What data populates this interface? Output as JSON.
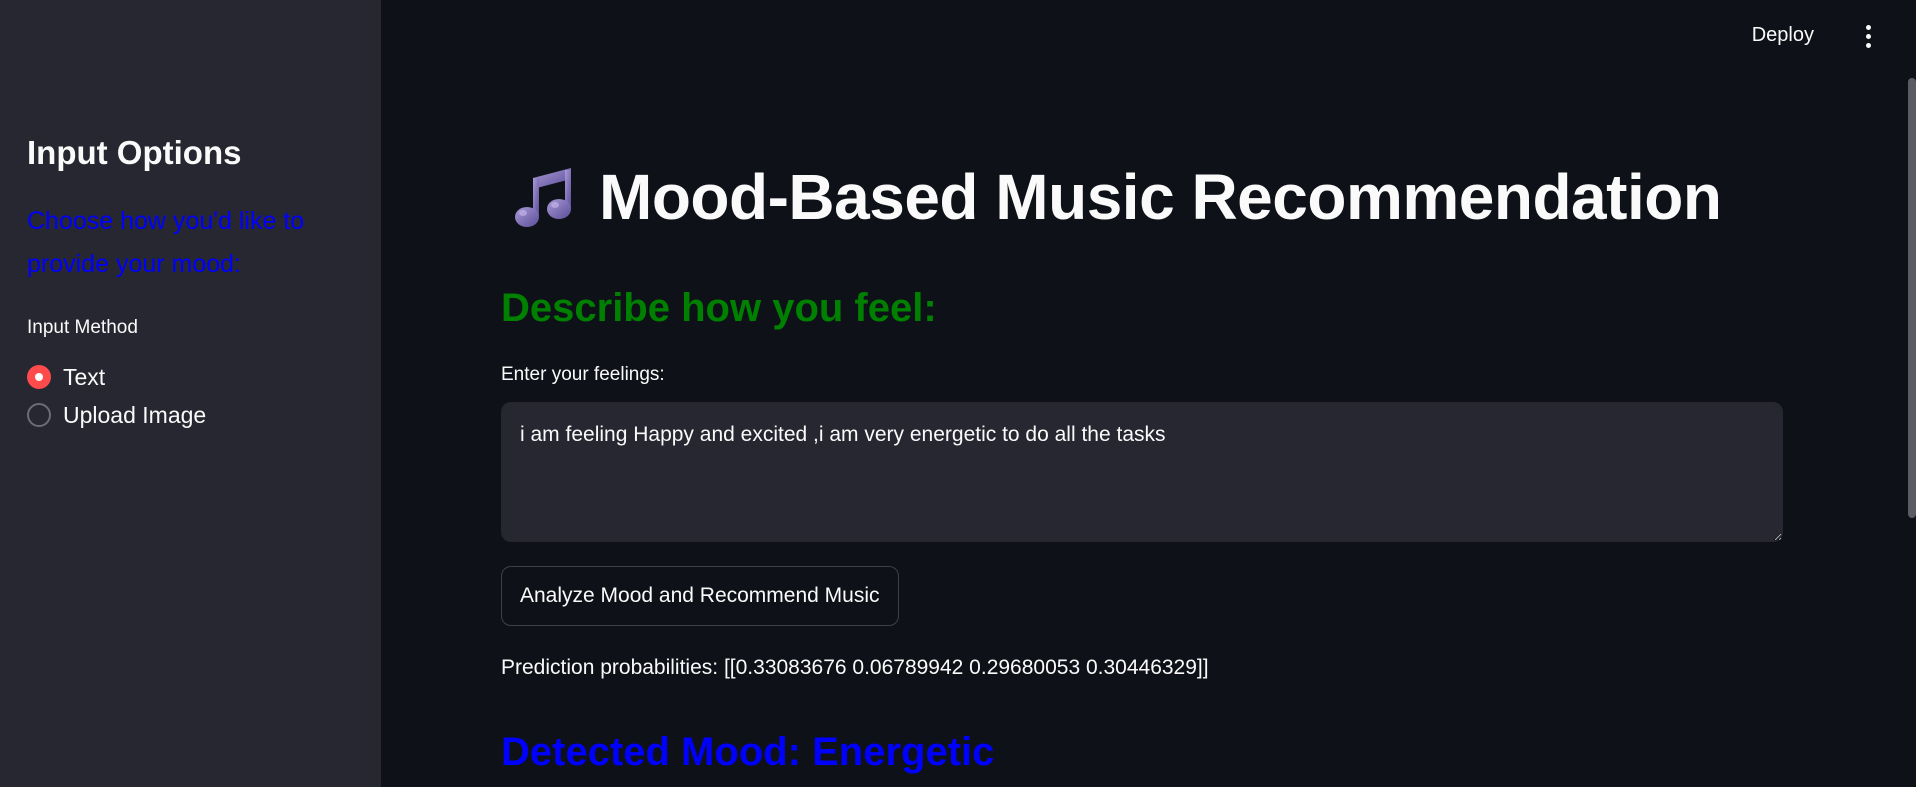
{
  "header": {
    "deploy_label": "Deploy",
    "menu_icon": "kebab-menu-icon"
  },
  "sidebar": {
    "title": "Input Options",
    "description": "Choose how you'd like to provide your mood:",
    "description_color": "#0000ff",
    "radio_label": "Input Method",
    "options": [
      {
        "label": "Text",
        "selected": true
      },
      {
        "label": "Upload Image",
        "selected": false
      }
    ],
    "accent_color": "#ff4b4b"
  },
  "main": {
    "title_icon": "musical-notes-icon",
    "title": "Mood-Based Music Recommendation",
    "subheader": "Describe how you feel:",
    "subheader_color": "#008000",
    "textarea_label": "Enter your feelings:",
    "textarea_value": "i am feeling Happy and excited ,i am very energetic to do all the tasks",
    "analyze_button_label": "Analyze Mood and Recommend Music",
    "prediction_text": "Prediction probabilities: [[0.33083676 0.06789942 0.29680053 0.30446329]]",
    "detected_mood": "Detected Mood: Energetic",
    "detected_mood_color": "#0000ff"
  },
  "theme": {
    "background": "#0e1117",
    "sidebar_background": "#262730",
    "text": "#fafafa"
  }
}
